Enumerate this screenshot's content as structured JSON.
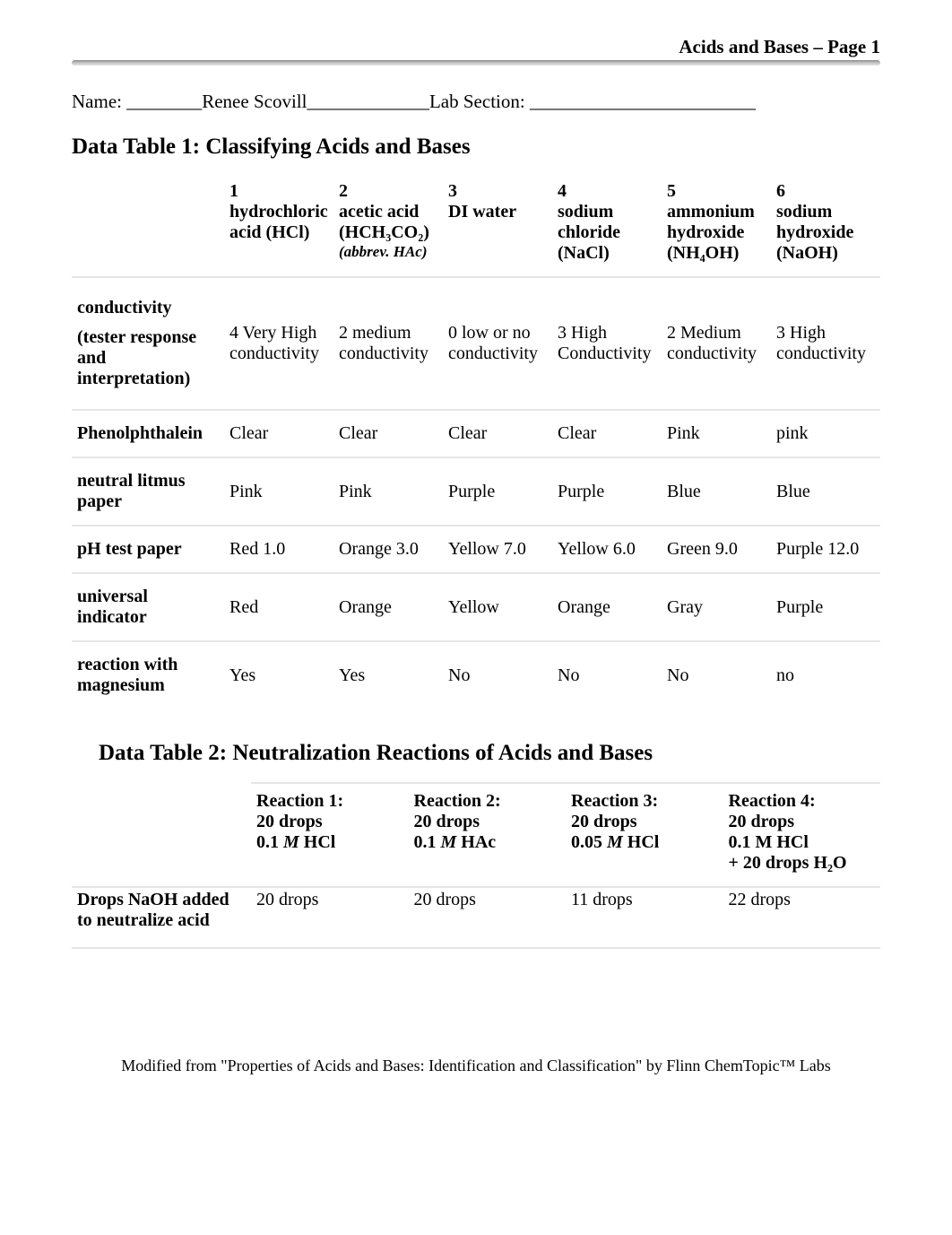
{
  "page_header": "Acids and Bases – Page 1",
  "name_line": {
    "prefix": "Name: ________",
    "name": "Renee Scovill",
    "mid": "_____________",
    "label2": "Lab Section: ________________________"
  },
  "section1_title": "Data Table 1: Classifying Acids and Bases",
  "table1": {
    "cols": [
      {
        "num": "1",
        "label_html": "hydrochloric acid (HCl)"
      },
      {
        "num": "2",
        "label_html": "acetic acid (HCH₃CO₂)",
        "sub": "(abbrev. HAc)"
      },
      {
        "num": "3",
        "label_html": "DI water"
      },
      {
        "num": "4",
        "label_html": "sodium chloride (NaCl)"
      },
      {
        "num": "5",
        "label_html": "ammonium hydroxide (NH₄OH)"
      },
      {
        "num": "6",
        "label_html": "sodium hydroxide (NaOH)"
      }
    ],
    "rows": [
      {
        "label": "conductivity\n\n(tester response and interpretation)",
        "cells": [
          "4 Very High conductivity",
          "2 medium conductivity",
          "0 low or no conductivity",
          "3 High Conductivity",
          "2 Medium conductivity",
          "3 High conductivity"
        ]
      },
      {
        "label": "Phenolphthalein",
        "cells": [
          "Clear",
          "Clear",
          "Clear",
          "Clear",
          "Pink",
          "pink"
        ]
      },
      {
        "label": "neutral litmus paper",
        "cells": [
          "Pink",
          "Pink",
          "Purple",
          "Purple",
          "Blue",
          "Blue"
        ]
      },
      {
        "label": "pH test paper",
        "cells": [
          "Red 1.0",
          "Orange 3.0",
          "Yellow 7.0",
          "Yellow 6.0",
          "Green 9.0",
          "Purple 12.0"
        ]
      },
      {
        "label": "universal indicator",
        "cells": [
          "Red",
          "Orange",
          "Yellow",
          "Orange",
          "Gray",
          "Purple"
        ]
      },
      {
        "label": "reaction with magnesium",
        "cells": [
          "Yes",
          "Yes",
          "No",
          "No",
          "No",
          "no"
        ]
      }
    ]
  },
  "section2_title": "Data Table 2: Neutralization Reactions of Acids and Bases",
  "table2": {
    "cols": [
      {
        "l1": "Reaction 1:",
        "l2": "20 drops",
        "l3": "0.1 M HCl"
      },
      {
        "l1": "Reaction 2:",
        "l2": "20 drops",
        "l3": "0.1 M HAc"
      },
      {
        "l1": "Reaction 3:",
        "l2": "20 drops",
        "l3": "0.05 M HCl"
      },
      {
        "l1": "Reaction 4:",
        "l2": "20 drops",
        "l3": "0.1 M HCl",
        "l4": "+ 20 drops H₂O"
      }
    ],
    "row": {
      "label": "Drops NaOH added to neutralize acid",
      "cells": [
        "20 drops",
        "20 drops",
        "11 drops",
        "22 drops"
      ]
    }
  },
  "footer": "Modified from \"Properties of Acids and Bases: Identification and Classification\" by Flinn ChemTopic™ Labs"
}
